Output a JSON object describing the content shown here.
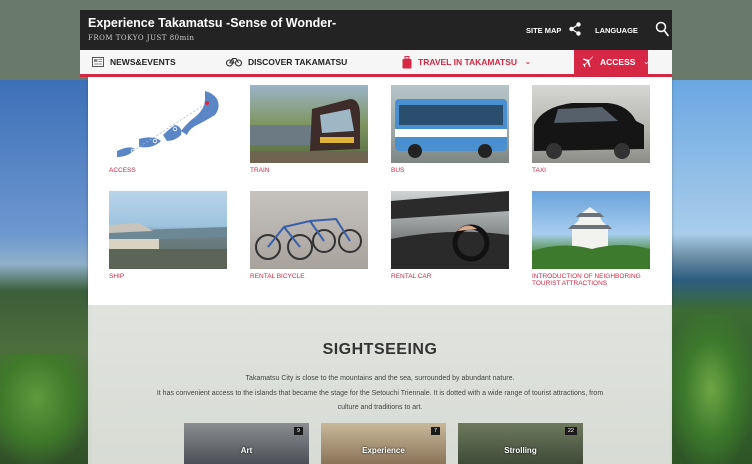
{
  "header": {
    "title": "Experience Takamatsu -Sense of Wonder-",
    "subtitle": "FROM TOKYO JUST 80min",
    "site_map": "SITE MAP",
    "language": "LANGUAGE"
  },
  "nav": {
    "items": [
      {
        "label": "NEWS&EVENTS",
        "icon": "newspaper-icon"
      },
      {
        "label": "DISCOVER TAKAMATSU",
        "icon": "bicycle-icon"
      },
      {
        "label": "TRAVEL IN TAKAMATSU",
        "icon": "suitcase-icon"
      },
      {
        "label": "ACCESS",
        "icon": "airplane-icon"
      }
    ]
  },
  "dropdown": {
    "items": [
      {
        "label": "ACCESS"
      },
      {
        "label": "TRAIN"
      },
      {
        "label": "BUS"
      },
      {
        "label": "TAXI"
      },
      {
        "label": "SHIP"
      },
      {
        "label": "RENTAL BICYCLE"
      },
      {
        "label": "RENTAL CAR"
      },
      {
        "label": "INTRODUCTION OF NEIGHBORING TOURIST ATTRACTIONS"
      }
    ]
  },
  "sightseeing": {
    "title": "SIGHTSEEING",
    "line1": "Takamatsu City is close to the mountains and the sea, surrounded by abundant nature.",
    "line2": "It has convenient access to the islands that became the stage for the Setouchi Triennale. It is dotted with a wide range of tourist attractions, from",
    "line3": "culture and traditions to art.",
    "categories": [
      {
        "label": "Art",
        "count": "9"
      },
      {
        "label": "Experience",
        "count": "7"
      },
      {
        "label": "Strolling",
        "count": "22"
      }
    ]
  },
  "colors": {
    "accent": "#d62845",
    "topbar": "#232323"
  }
}
